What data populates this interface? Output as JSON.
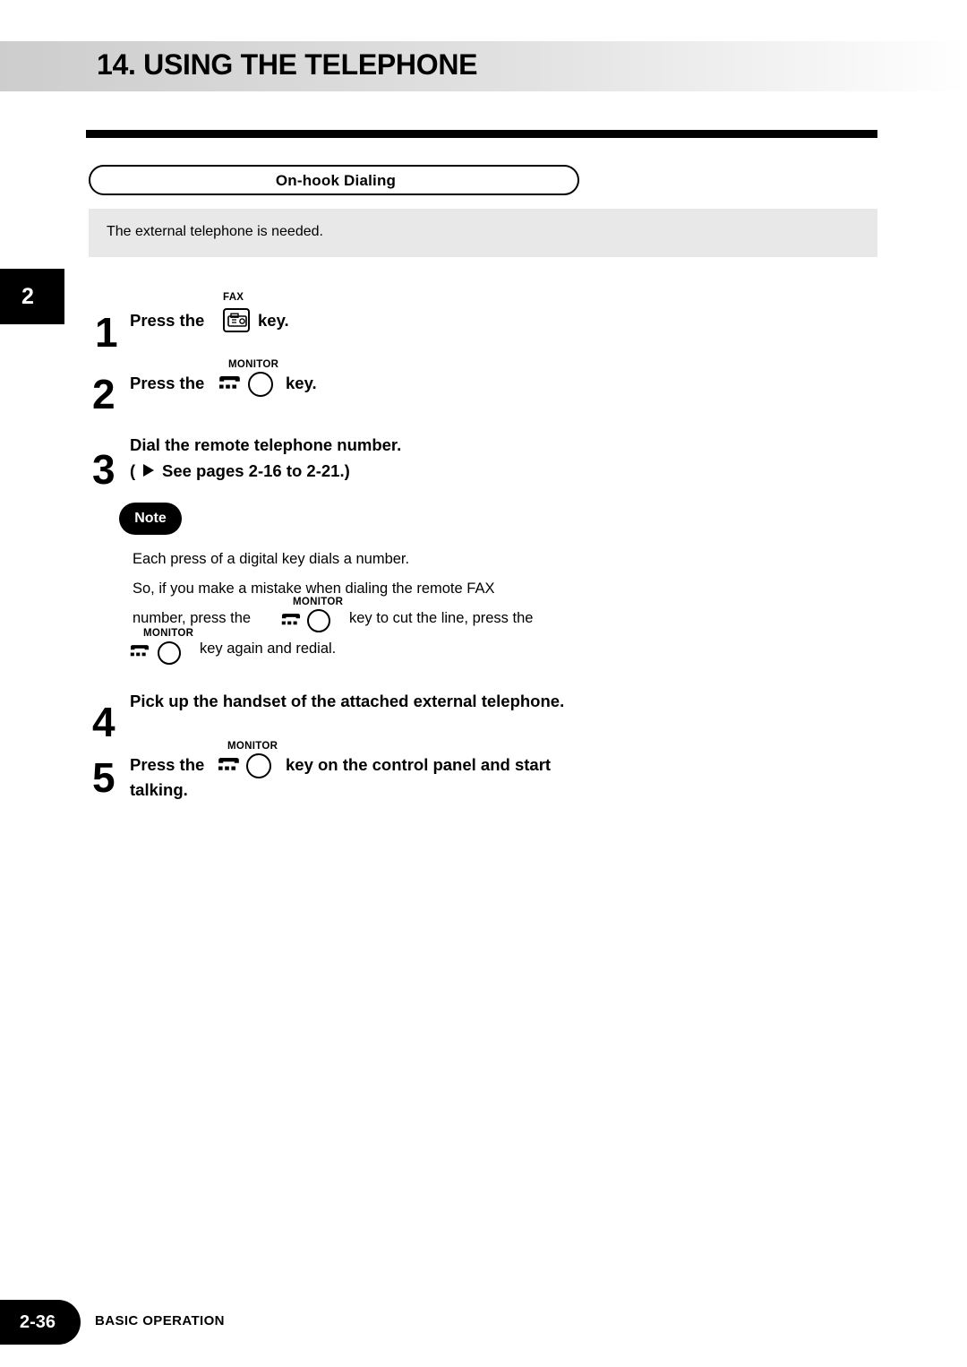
{
  "header": {
    "title": "14. USING THE TELEPHONE"
  },
  "section": {
    "title": "On-hook Dialing"
  },
  "intro": {
    "text": "The external telephone is needed."
  },
  "chapter_tab": {
    "number": "2"
  },
  "keys": {
    "fax_label": "FAX",
    "monitor_label": "MONITOR"
  },
  "steps": [
    {
      "number": "1",
      "text_before": "Press the",
      "text_after": "key."
    },
    {
      "number": "2",
      "text_before": "Press the",
      "text_after": "key."
    },
    {
      "number": "3",
      "line1": "Dial the remote telephone number.",
      "line2_prefix": "(",
      "line2": "See pages 2-16 to 2-21.)"
    },
    {
      "number": "4",
      "text": "Pick up the handset of the attached external telephone."
    },
    {
      "number": "5",
      "text_before": "Press the",
      "text_after": "key on the control panel and start",
      "line2": "talking."
    }
  ],
  "note": {
    "badge": "Note",
    "line1": "Each press of a digital key dials a number.",
    "line2": "So, if you make a mistake when dialing the remote FAX",
    "line3_a": "number, press the",
    "line3_b": "key to cut the line, press the",
    "line4": "key again and redial."
  },
  "footer": {
    "page": "2-36",
    "section": "BASIC OPERATION"
  }
}
